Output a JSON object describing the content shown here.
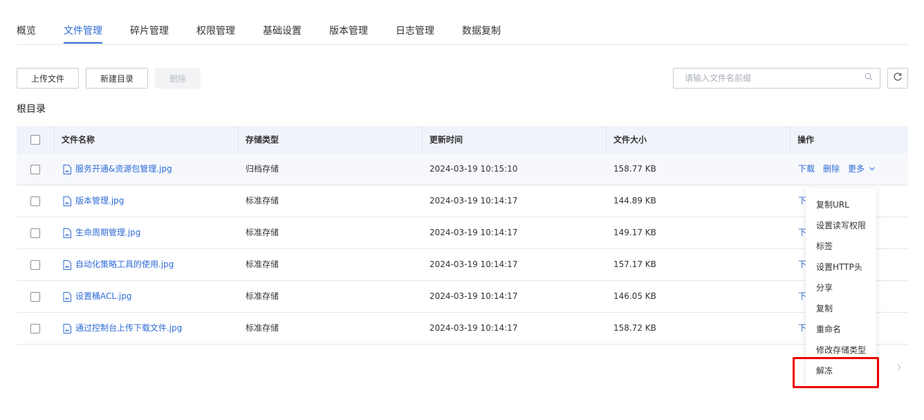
{
  "tabs": [
    "概览",
    "文件管理",
    "碎片管理",
    "权限管理",
    "基础设置",
    "版本管理",
    "日志管理",
    "数据复制"
  ],
  "active_tab": "文件管理",
  "toolbar": {
    "upload": "上传文件",
    "new_dir": "新建目录",
    "delete": "删除"
  },
  "search": {
    "placeholder": "请输入文件名前缀"
  },
  "breadcrumb": "根目录",
  "table": {
    "headers": [
      "文件名称",
      "存储类型",
      "更新时间",
      "文件大小",
      "操作"
    ],
    "rows": [
      {
        "name": "服务开通&资源包管理.jpg",
        "storage": "归档存储",
        "time": "2024-03-19 10:15:10",
        "size": "158.77 KB"
      },
      {
        "name": "版本管理.jpg",
        "storage": "标准存储",
        "time": "2024-03-19 10:14:17",
        "size": "144.89 KB"
      },
      {
        "name": "生命周期管理.jpg",
        "storage": "标准存储",
        "time": "2024-03-19 10:14:17",
        "size": "149.17 KB"
      },
      {
        "name": "自动化策略工具的使用.jpg",
        "storage": "标准存储",
        "time": "2024-03-19 10:14:17",
        "size": "157.17 KB"
      },
      {
        "name": "设置桶ACL.jpg",
        "storage": "标准存储",
        "time": "2024-03-19 10:14:17",
        "size": "146.05 KB"
      },
      {
        "name": "通过控制台上传下载文件.jpg",
        "storage": "标准存储",
        "time": "2024-03-19 10:14:17",
        "size": "158.72 KB"
      }
    ],
    "actions": {
      "download": "下载",
      "delete": "删除",
      "more": "更多",
      "download_partial": "下"
    }
  },
  "more_menu": [
    "复制URL",
    "设置读写权限",
    "标签",
    "设置HTTP头",
    "分享",
    "复制",
    "重命名",
    "修改存储类型",
    "解冻"
  ],
  "colors": {
    "accent": "#2e6bd6",
    "highlight": "#f00000",
    "header_bg": "#f0f3fa"
  }
}
